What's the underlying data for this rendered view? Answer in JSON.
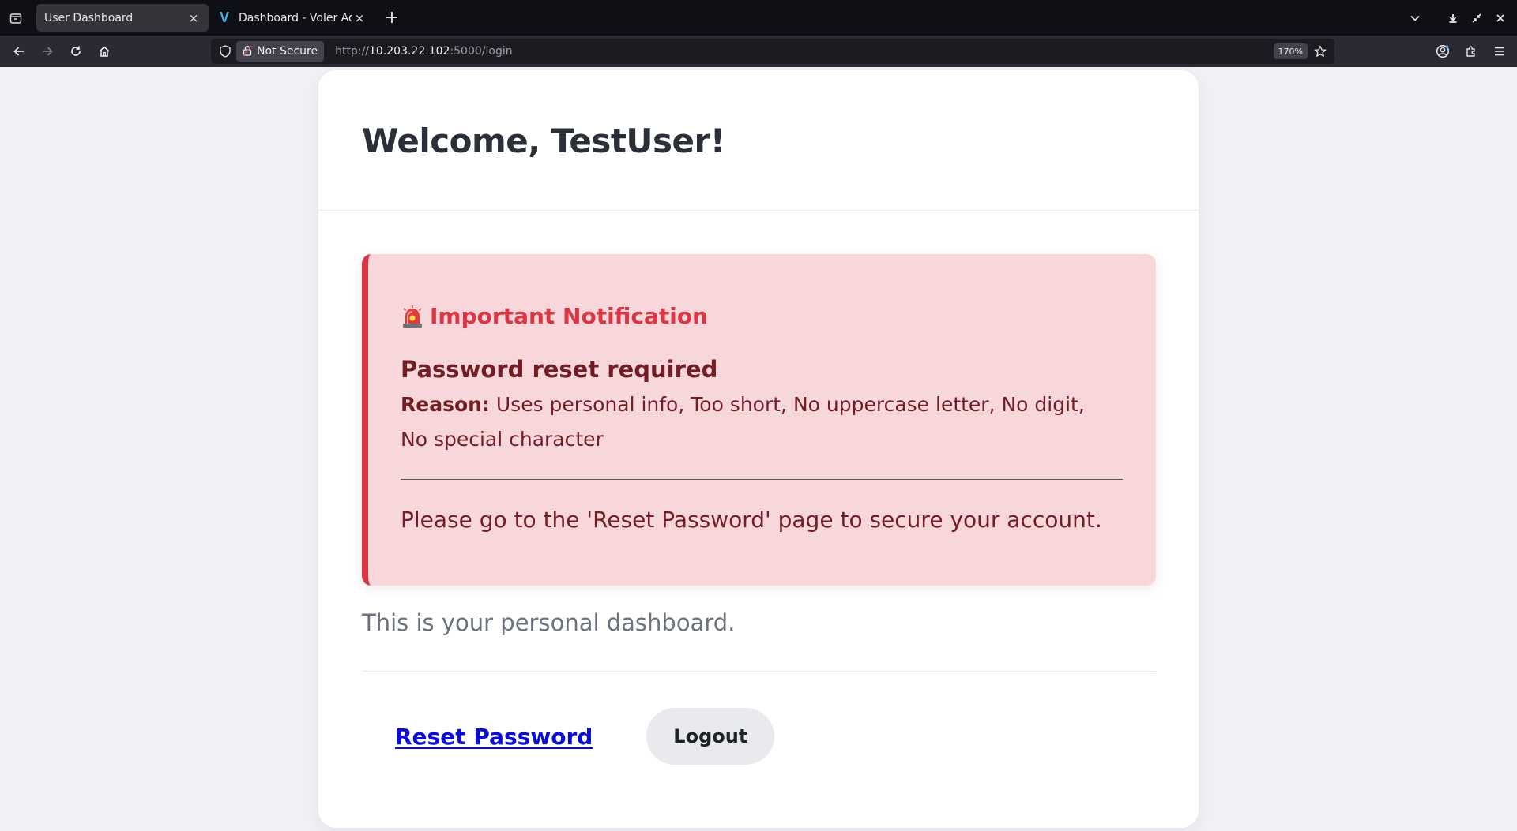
{
  "browser": {
    "tabs": [
      {
        "title": "User Dashboard",
        "active": true
      },
      {
        "title": "Dashboard - Voler Admin D",
        "active": false,
        "favicon": "V"
      }
    ],
    "close_glyph": "×",
    "new_tab_glyph": "+",
    "security_label": "Not Secure",
    "url": {
      "scheme": "http://",
      "host": "10.203.22.102",
      "rest": ":5000/login"
    },
    "zoom": "170%"
  },
  "page": {
    "welcome": "Welcome, TestUser!",
    "alert": {
      "title": "Important Notification",
      "heading": "Password reset required",
      "reason_label": "Reason:",
      "reason_text": " Uses personal info, Too short, No uppercase letter, No digit, No special character",
      "footer": "Please go to the 'Reset Password' page to secure your account."
    },
    "dashboard_text": "This is your personal dashboard.",
    "reset_link": "Reset Password",
    "logout_label": "Logout"
  },
  "colors": {
    "alert_bg": "#f8d7da",
    "alert_border": "#dc3545",
    "alert_text": "#721c24",
    "link": "#0b0bd8"
  },
  "icons": [
    "tab-list-icon",
    "close-icon",
    "plus-icon",
    "chevron-down-icon",
    "download-icon",
    "restore-icon",
    "close-window-icon",
    "back-icon",
    "forward-icon",
    "reload-icon",
    "home-icon",
    "shield-icon",
    "lock-icon",
    "star-icon",
    "account-icon",
    "extensions-icon",
    "menu-icon",
    "siren-icon"
  ]
}
